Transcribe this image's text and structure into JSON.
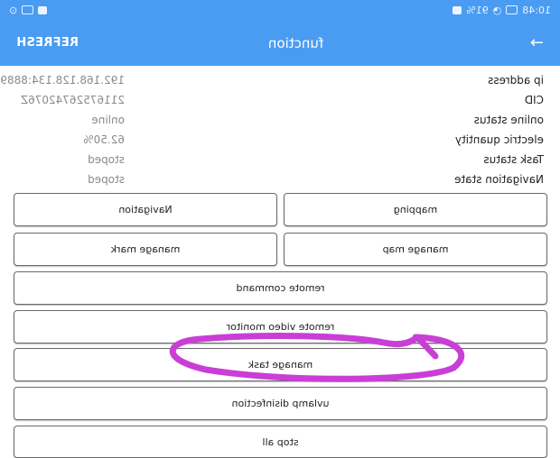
{
  "status_bar": {
    "time": "10:48",
    "battery": "91%"
  },
  "header": {
    "title": "function",
    "refresh_label": "REFRESH",
    "back_icon": "→"
  },
  "info": [
    {
      "label": "ip address",
      "value": "192.168.128.134:8889"
    },
    {
      "label": "CID",
      "value": "21167526742076Z"
    },
    {
      "label": "online status",
      "value": "online"
    },
    {
      "label": "electric quantity",
      "value": "62.50%"
    },
    {
      "label": "Task status",
      "value": "stoped"
    },
    {
      "label": "Navigation state",
      "value": "stoped"
    }
  ],
  "buttons": {
    "mapping": "mapping",
    "navigation": "Navigation",
    "manage_map": "manage map",
    "manage_mark": "manage mark",
    "remote_command": "remote command",
    "remote_video_monitor": "remote video monitor",
    "manage_task": "manage task",
    "uvlamp_disinfection": "uvlamp disinfection",
    "stop_all": "stop all"
  },
  "colors": {
    "appbar": "#4a9cf3",
    "annotation": "#c93fd6"
  }
}
